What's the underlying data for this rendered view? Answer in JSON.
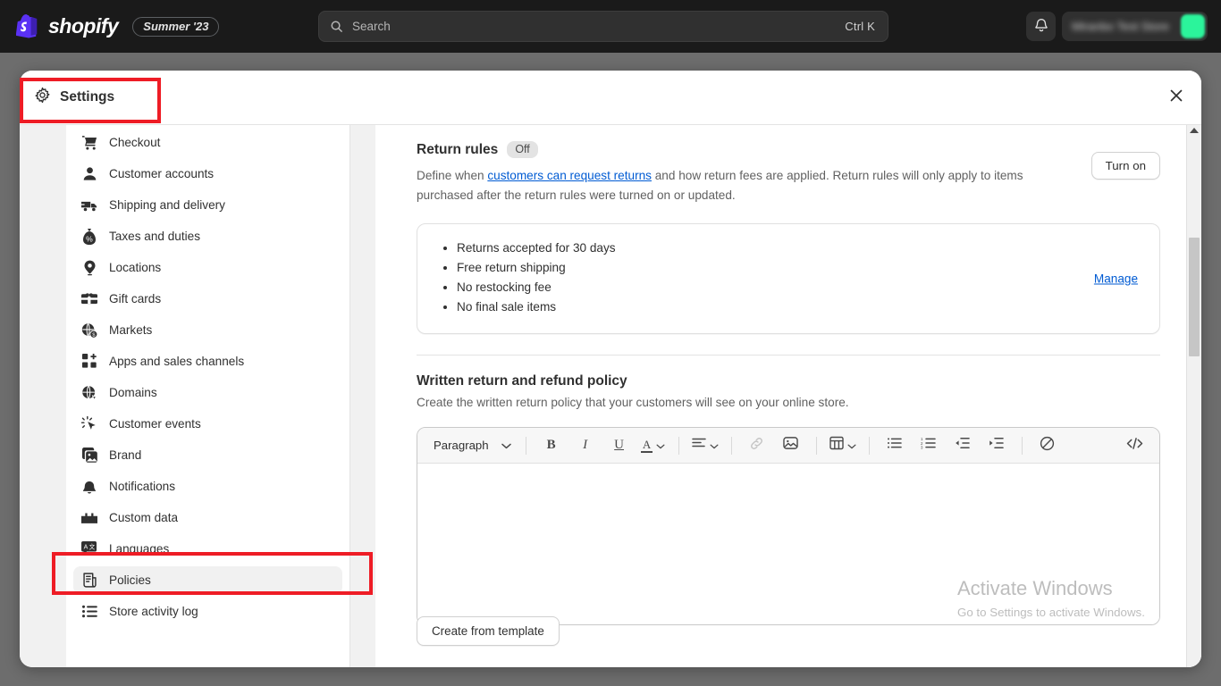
{
  "topbar": {
    "brand_name": "shopify",
    "brand_icon": "shopify-bag-icon",
    "season_badge": "Summer '23",
    "search": {
      "placeholder": "Search",
      "shortcut": "Ctrl K",
      "icon": "search-icon"
    },
    "notifications_icon": "bell-icon",
    "store_name": "Miranbo Test Store",
    "avatar_color": "#2bf49b"
  },
  "modal": {
    "title": "Settings",
    "title_icon": "gear-icon",
    "close_icon": "close-icon"
  },
  "sidebar": {
    "items": [
      {
        "label": "Checkout",
        "icon": "cart-icon",
        "active": false
      },
      {
        "label": "Customer accounts",
        "icon": "person-icon",
        "active": false
      },
      {
        "label": "Shipping and delivery",
        "icon": "truck-icon",
        "active": false
      },
      {
        "label": "Taxes and duties",
        "icon": "money-bag-icon",
        "active": false
      },
      {
        "label": "Locations",
        "icon": "location-pin-icon",
        "active": false
      },
      {
        "label": "Gift cards",
        "icon": "gift-card-icon",
        "active": false
      },
      {
        "label": "Markets",
        "icon": "globe-dollar-icon",
        "active": false
      },
      {
        "label": "Apps and sales channels",
        "icon": "apps-plus-icon",
        "active": false
      },
      {
        "label": "Domains",
        "icon": "globe-icon",
        "active": false
      },
      {
        "label": "Customer events",
        "icon": "cursor-click-icon",
        "active": false
      },
      {
        "label": "Brand",
        "icon": "image-icon",
        "active": false
      },
      {
        "label": "Notifications",
        "icon": "bell-icon",
        "active": false
      },
      {
        "label": "Custom data",
        "icon": "blocks-icon",
        "active": false
      },
      {
        "label": "Languages",
        "icon": "translate-icon",
        "active": false
      },
      {
        "label": "Policies",
        "icon": "policy-scroll-icon",
        "active": true
      },
      {
        "label": "Store activity log",
        "icon": "list-icon",
        "active": false
      }
    ]
  },
  "main": {
    "return_rules": {
      "title": "Return rules",
      "status_badge": "Off",
      "description_part1": "Define when ",
      "description_link": "customers can request returns",
      "description_part2": " and how return fees are applied. Return rules will only apply to items purchased after the return rules were turned on or updated.",
      "turn_on_label": "Turn on",
      "rules": [
        "Returns accepted for 30 days",
        "Free return shipping",
        "No restocking fee",
        "No final sale items"
      ],
      "manage_label": "Manage",
      "link_color": "#005bd3"
    },
    "written_policy": {
      "title": "Written return and refund policy",
      "description": "Create the written return policy that your customers will see on your online store.",
      "editor": {
        "block_format": "Paragraph",
        "content": "",
        "tools": [
          {
            "name": "block-format-dropdown",
            "label": "Paragraph",
            "icon": "chevron-down-icon"
          },
          {
            "name": "bold-button",
            "label": "B",
            "icon": "bold-icon"
          },
          {
            "name": "italic-button",
            "label": "I",
            "icon": "italic-icon"
          },
          {
            "name": "underline-button",
            "label": "U",
            "icon": "underline-icon"
          },
          {
            "name": "text-color-button",
            "label": "A",
            "icon": "text-color-icon"
          },
          {
            "name": "align-button",
            "label": "",
            "icon": "align-left-icon"
          },
          {
            "name": "link-button",
            "label": "",
            "icon": "link-icon"
          },
          {
            "name": "image-button",
            "label": "",
            "icon": "image-icon"
          },
          {
            "name": "table-button",
            "label": "",
            "icon": "table-icon"
          },
          {
            "name": "bulleted-list-button",
            "label": "",
            "icon": "bulleted-list-icon"
          },
          {
            "name": "numbered-list-button",
            "label": "",
            "icon": "numbered-list-icon"
          },
          {
            "name": "outdent-button",
            "label": "",
            "icon": "outdent-icon"
          },
          {
            "name": "indent-button",
            "label": "",
            "icon": "indent-icon"
          },
          {
            "name": "clear-formatting-button",
            "label": "",
            "icon": "no-formatting-icon"
          },
          {
            "name": "html-source-button",
            "label": "",
            "icon": "code-icon"
          }
        ]
      },
      "create_from_template_label": "Create from template"
    }
  },
  "watermark": {
    "line1": "Activate Windows",
    "line2": "Go to Settings to activate Windows."
  },
  "annotations": {
    "highlight_color": "#ee1c25",
    "boxes": [
      {
        "name": "settings-title-highlight"
      },
      {
        "name": "policies-item-highlight"
      }
    ]
  }
}
